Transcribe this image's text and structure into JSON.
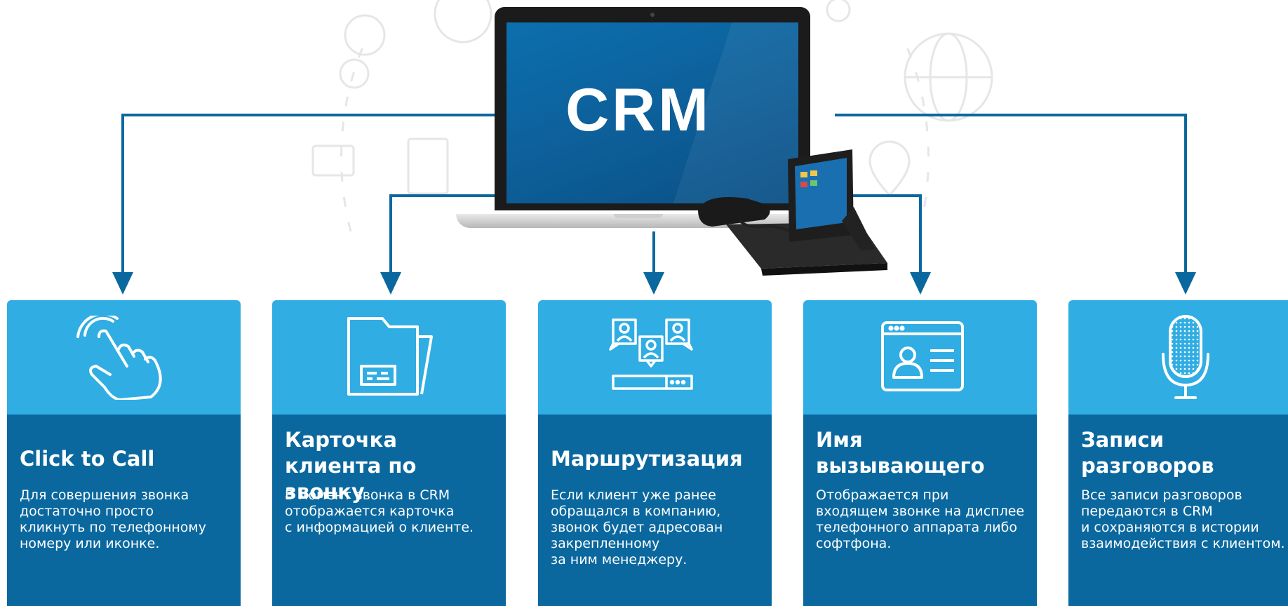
{
  "laptop": {
    "screen_text": "CRM"
  },
  "cards": [
    {
      "title": "Click to Call",
      "text": "Для совершения звонка\nдостаточно просто\nкликнуть по телефонному\nномеру или иконке.",
      "icon": "hand-touch-icon"
    },
    {
      "title": "Карточка клиента по звонку",
      "text": "В момент звонка в CRM\nотображается карточка\nс информацией о клиенте.",
      "icon": "folder-card-icon"
    },
    {
      "title": "Маршрутизация",
      "text": "Если клиент уже ранее\nобращался в компанию,\nзвонок будет адресован\nзакрепленному\nза ним менеджеру.",
      "icon": "routing-users-icon"
    },
    {
      "title": "Имя вызывающего",
      "text": "Отображается при\nвходящем звонке на дисплее\nтелефонного аппарата либо\nсофтфона.",
      "icon": "contact-window-icon"
    },
    {
      "title": "Записи разговоров",
      "text": "Все записи разговоров\nпередаются  в CRM\nи сохраняются в истории\nвзаимодействия с клиентом.",
      "icon": "microphone-icon"
    }
  ],
  "colors": {
    "card_top": "#30ade3",
    "card_bottom": "#0a689f",
    "connector": "#0a689f",
    "screen": "#0c6fae"
  }
}
